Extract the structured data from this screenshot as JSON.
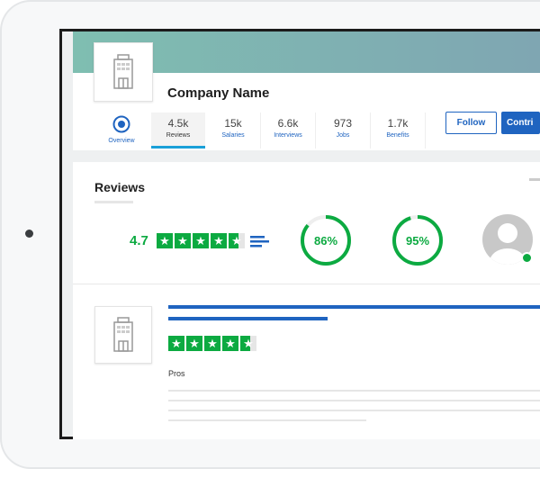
{
  "company": {
    "name": "Company Name"
  },
  "tabs": [
    {
      "value": "",
      "label": "Overview",
      "icon": "target-icon"
    },
    {
      "value": "4.5k",
      "label": "Reviews",
      "active": true
    },
    {
      "value": "15k",
      "label": "Salaries"
    },
    {
      "value": "6.6k",
      "label": "Interviews"
    },
    {
      "value": "973",
      "label": "Jobs"
    },
    {
      "value": "1.7k",
      "label": "Benefits"
    }
  ],
  "buttons": {
    "follow": "Follow",
    "contribute": "Contri"
  },
  "reviews": {
    "title": "Reviews",
    "rating": "4.7",
    "rating_value": 4.7,
    "stats": [
      {
        "label": "86%",
        "value": 86
      },
      {
        "label": "95%",
        "value": 95
      }
    ]
  },
  "review_item": {
    "rating_value": 4.5,
    "pros_label": "Pros"
  },
  "colors": {
    "green": "#0caa41",
    "blue": "#1f64c0",
    "teal": "#7fbeb1"
  }
}
